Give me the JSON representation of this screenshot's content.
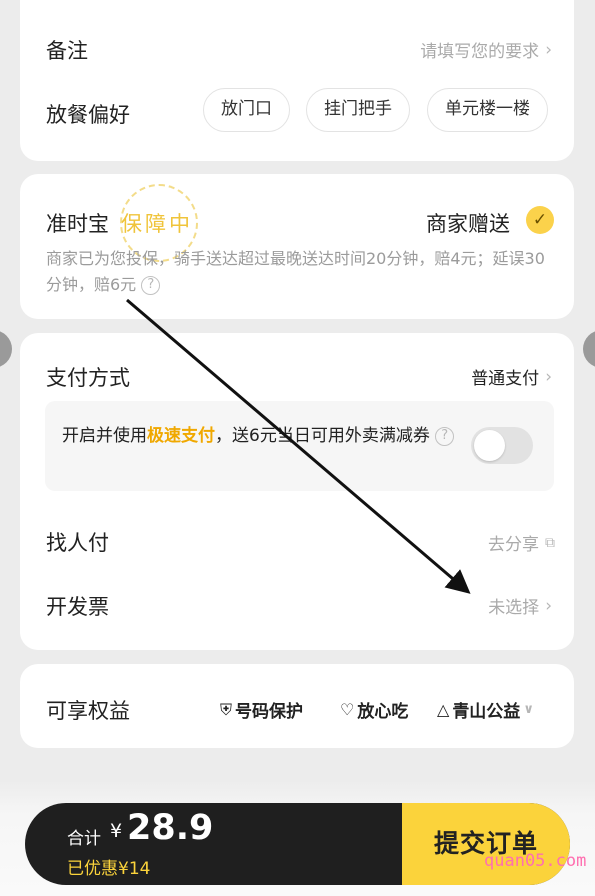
{
  "remarks": {
    "label": "备注",
    "placeholder": "请填写您的要求"
  },
  "meal_preference": {
    "label": "放餐偏好",
    "options": [
      "放门口",
      "挂门把手",
      "单元楼一楼"
    ]
  },
  "guarantee": {
    "title": "准时宝",
    "badge": "保障中",
    "status": "商家赠送",
    "description": "商家已为您投保，骑手送达超过最晚送达时间20分钟，赔4元；延误30分钟，赔6元",
    "help_glyph": "?"
  },
  "payment": {
    "label": "支付方式",
    "value": "普通支付",
    "fast_pay": {
      "prefix": "开启并使用",
      "highlight": "极速支付",
      "suffix": "，送6元当日可用外卖满减券",
      "help_glyph": "?",
      "enabled": false
    },
    "find_payer": {
      "label": "找人付",
      "value": "去分享"
    },
    "invoice": {
      "label": "开发票",
      "value": "未选择"
    }
  },
  "benefits": {
    "label": "可享权益",
    "items": [
      {
        "icon": "shield-icon",
        "label": "号码保护"
      },
      {
        "icon": "heart-icon",
        "label": "放心吃"
      },
      {
        "icon": "mountain-icon",
        "label": "青山公益"
      }
    ]
  },
  "checkout": {
    "total_label": "合计",
    "currency": "¥",
    "total": "28.9",
    "discount": "已优惠¥14",
    "submit_label": "提交订单"
  },
  "watermark": "quan05.com",
  "colors": {
    "accent_yellow": "#fbd33b",
    "highlight_orange": "#f0a800",
    "bar_dark": "#1f1f1f"
  }
}
